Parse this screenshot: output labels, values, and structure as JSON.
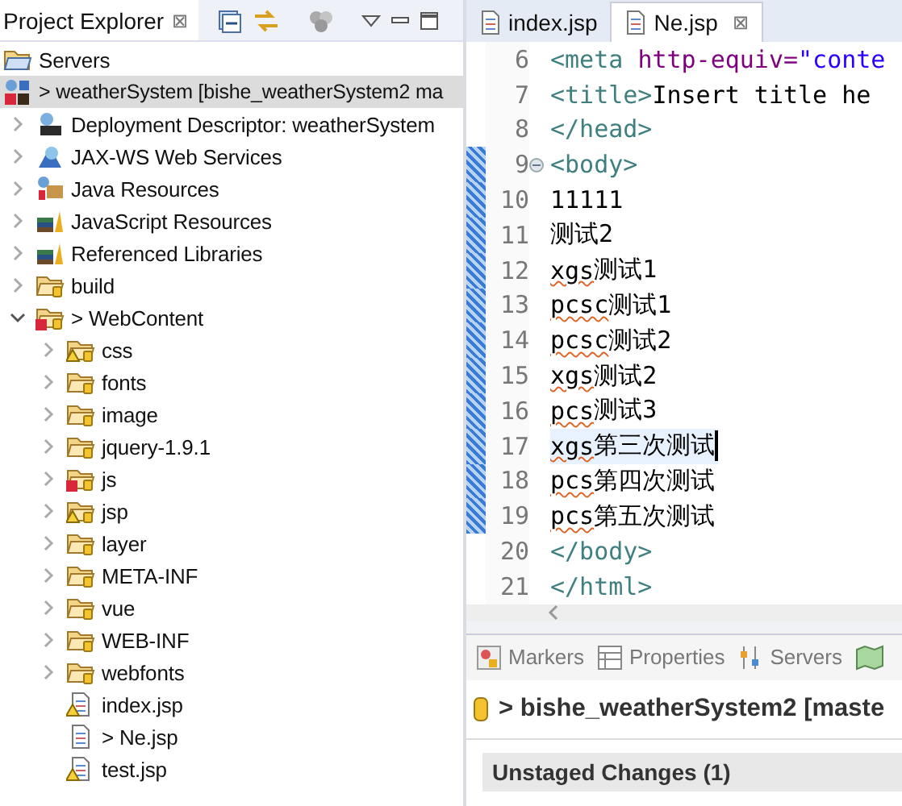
{
  "explorer": {
    "title": "Project Explorer",
    "close": "⊠",
    "tree": [
      {
        "label": "Servers",
        "kind": "servers",
        "selected": false
      },
      {
        "label": "> weatherSystem [bishe_weatherSystem2 ma",
        "kind": "project",
        "selected": true,
        "children": [
          {
            "label": "Deployment Descriptor: weatherSystem",
            "kind": "descriptor",
            "expanded": false,
            "selected": false
          },
          {
            "label": "JAX-WS Web Services",
            "kind": "web-services",
            "expanded": false,
            "selected": false
          },
          {
            "label": "Java Resources",
            "kind": "java-resources",
            "expanded": false,
            "selected": false
          },
          {
            "label": "JavaScript Resources",
            "kind": "library",
            "expanded": false,
            "selected": false
          },
          {
            "label": "Referenced Libraries",
            "kind": "library",
            "expanded": false,
            "selected": false
          },
          {
            "label": "build",
            "kind": "folder",
            "expanded": false,
            "selected": false
          },
          {
            "label": "> WebContent",
            "kind": "folder-error",
            "expanded": true,
            "selected": false,
            "children": [
              {
                "label": "css",
                "kind": "folder-warning",
                "expanded": false,
                "selected": false
              },
              {
                "label": "fonts",
                "kind": "folder",
                "expanded": false,
                "selected": false
              },
              {
                "label": "image",
                "kind": "folder",
                "expanded": false,
                "selected": false
              },
              {
                "label": "jquery-1.9.1",
                "kind": "folder",
                "expanded": false,
                "selected": false
              },
              {
                "label": "js",
                "kind": "folder-error",
                "expanded": false,
                "selected": false
              },
              {
                "label": "jsp",
                "kind": "folder-warning",
                "expanded": false,
                "selected": false
              },
              {
                "label": "layer",
                "kind": "folder",
                "expanded": false,
                "selected": false
              },
              {
                "label": "META-INF",
                "kind": "folder",
                "expanded": false,
                "selected": false
              },
              {
                "label": "vue",
                "kind": "folder",
                "expanded": false,
                "selected": false
              },
              {
                "label": "WEB-INF",
                "kind": "folder",
                "expanded": false,
                "selected": false
              },
              {
                "label": "webfonts",
                "kind": "folder",
                "expanded": false,
                "selected": false
              },
              {
                "label": "index.jsp",
                "kind": "file-warning",
                "selected": false
              },
              {
                "label": "> Ne.jsp",
                "kind": "file",
                "selected": false
              },
              {
                "label": "test.jsp",
                "kind": "file-warning",
                "selected": false
              }
            ]
          }
        ]
      }
    ]
  },
  "editor": {
    "tabs": [
      {
        "label": "index.jsp",
        "selected": false
      },
      {
        "label": "Ne.jsp",
        "selected": true,
        "close": "⊠"
      }
    ],
    "lines": [
      {
        "number": "6",
        "changed": false,
        "current": false,
        "fold": false,
        "tokens": [
          {
            "t": "<meta ",
            "kind": "tag"
          },
          {
            "t": "http-equiv=",
            "kind": "attr"
          },
          {
            "t": "\"conte",
            "kind": "string"
          }
        ]
      },
      {
        "number": "7",
        "changed": false,
        "current": false,
        "fold": false,
        "tokens": [
          {
            "t": "<title>",
            "kind": "tag"
          },
          {
            "t": "Insert title he",
            "kind": "text"
          }
        ]
      },
      {
        "number": "8",
        "changed": false,
        "current": false,
        "fold": false,
        "tokens": [
          {
            "t": "</head>",
            "kind": "tag"
          }
        ]
      },
      {
        "number": "9",
        "changed": true,
        "current": false,
        "fold": true,
        "tokens": [
          {
            "t": "<body>",
            "kind": "tag"
          }
        ]
      },
      {
        "number": "10",
        "changed": true,
        "current": false,
        "fold": false,
        "tokens": [
          {
            "t": "11111",
            "kind": "text"
          }
        ]
      },
      {
        "number": "11",
        "changed": true,
        "current": false,
        "fold": false,
        "tokens": [
          {
            "t": "测试2",
            "kind": "text"
          }
        ]
      },
      {
        "number": "12",
        "changed": true,
        "current": false,
        "fold": false,
        "tokens": [
          {
            "t": "xgs",
            "kind": "misspelled"
          },
          {
            "t": "测试1",
            "kind": "text"
          }
        ]
      },
      {
        "number": "13",
        "changed": true,
        "current": false,
        "fold": false,
        "tokens": [
          {
            "t": "pcsc",
            "kind": "misspelled"
          },
          {
            "t": "测试1",
            "kind": "text"
          }
        ]
      },
      {
        "number": "14",
        "changed": true,
        "current": false,
        "fold": false,
        "tokens": [
          {
            "t": "pcsc",
            "kind": "misspelled"
          },
          {
            "t": "测试2",
            "kind": "text"
          }
        ]
      },
      {
        "number": "15",
        "changed": true,
        "current": false,
        "fold": false,
        "tokens": [
          {
            "t": "xgs",
            "kind": "misspelled"
          },
          {
            "t": "测试2",
            "kind": "text"
          }
        ]
      },
      {
        "number": "16",
        "changed": true,
        "current": false,
        "fold": false,
        "tokens": [
          {
            "t": "pcs",
            "kind": "misspelled"
          },
          {
            "t": "测试3",
            "kind": "text"
          }
        ]
      },
      {
        "number": "17",
        "changed": true,
        "current": true,
        "fold": false,
        "tokens": [
          {
            "t": "xgs",
            "kind": "misspelled"
          },
          {
            "t": "第三次测试",
            "kind": "text"
          }
        ]
      },
      {
        "number": "18",
        "changed": true,
        "current": false,
        "fold": false,
        "tokens": [
          {
            "t": "pcs",
            "kind": "misspelled"
          },
          {
            "t": "第四次测试",
            "kind": "text"
          }
        ]
      },
      {
        "number": "19",
        "changed": true,
        "current": false,
        "fold": false,
        "tokens": [
          {
            "t": "pcs",
            "kind": "misspelled"
          },
          {
            "t": "第五次测试",
            "kind": "text"
          }
        ]
      },
      {
        "number": "20",
        "changed": false,
        "current": false,
        "fold": false,
        "tokens": [
          {
            "t": "</body>",
            "kind": "tag"
          }
        ]
      },
      {
        "number": "21",
        "changed": false,
        "current": false,
        "fold": false,
        "tokens": [
          {
            "t": "</html>",
            "kind": "tag"
          }
        ]
      }
    ]
  },
  "bottom": {
    "tabs": [
      {
        "label": "Markers",
        "kind": "markers"
      },
      {
        "label": "Properties",
        "kind": "properties"
      },
      {
        "label": "Servers",
        "kind": "servers"
      },
      {
        "kind": "map"
      }
    ],
    "repository": "> bishe_weatherSystem2 [maste",
    "section": "Unstaged Changes (1)"
  }
}
